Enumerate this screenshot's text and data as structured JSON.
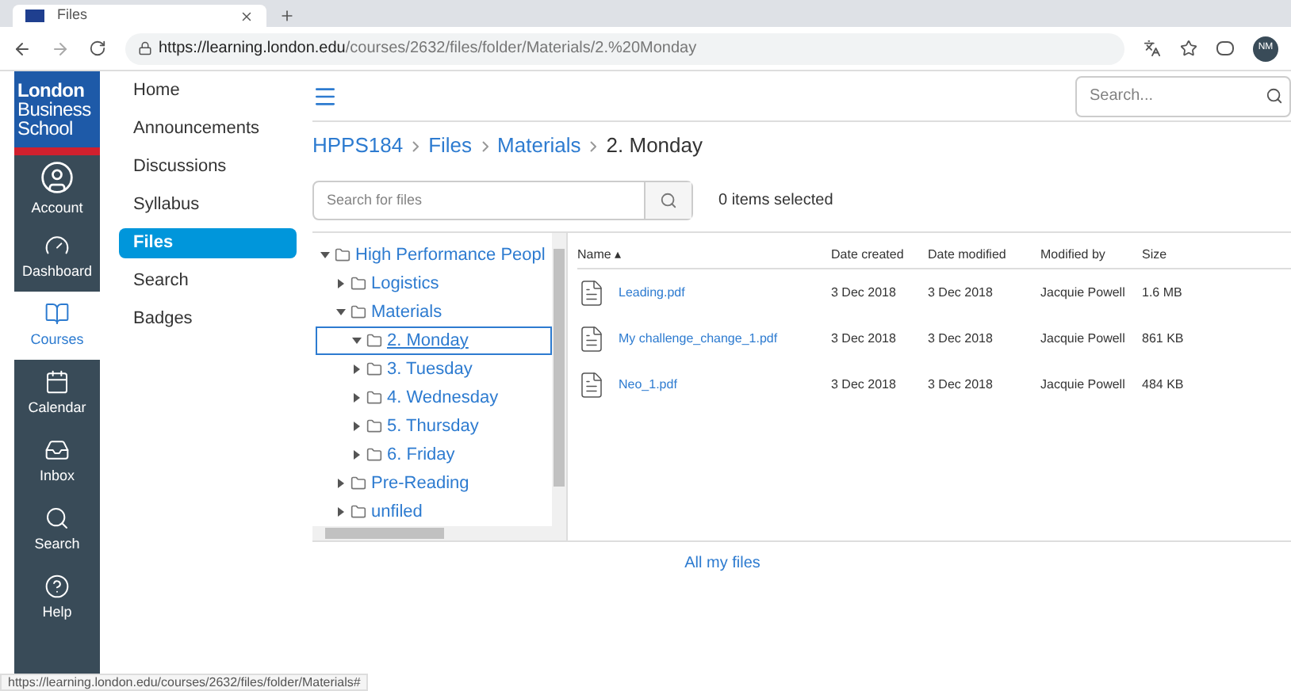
{
  "browser": {
    "tab_title": "Files",
    "url_host": "https://learning.london.edu",
    "url_path": "/courses/2632/files/folder/Materials/2.%20Monday",
    "profile": "NM"
  },
  "logo": [
    "London",
    "Business",
    "School"
  ],
  "global_nav": [
    {
      "label": "Account",
      "kind": "account",
      "selected": false
    },
    {
      "label": "Dashboard",
      "kind": "dashboard",
      "selected": false
    },
    {
      "label": "Courses",
      "kind": "courses",
      "selected": true
    },
    {
      "label": "Calendar",
      "kind": "calendar",
      "selected": false
    },
    {
      "label": "Inbox",
      "kind": "inbox",
      "selected": false
    },
    {
      "label": "Search",
      "kind": "search",
      "selected": false
    },
    {
      "label": "Help",
      "kind": "help",
      "selected": false
    }
  ],
  "course_nav": [
    {
      "label": "Home",
      "selected": false
    },
    {
      "label": "Announcements",
      "selected": false
    },
    {
      "label": "Discussions",
      "selected": false
    },
    {
      "label": "Syllabus",
      "selected": false
    },
    {
      "label": "Files",
      "selected": true
    },
    {
      "label": "Search",
      "selected": false
    },
    {
      "label": "Badges",
      "selected": false
    }
  ],
  "top_search": {
    "placeholder": "Search..."
  },
  "breadcrumbs": [
    "HPPS184",
    "Files",
    "Materials",
    "2. Monday"
  ],
  "file_search": {
    "placeholder": "Search for files"
  },
  "selection_count": "0 items selected",
  "folder_tree": [
    {
      "label": "High Performance Peopl",
      "expanded": true,
      "selected": false,
      "children": [
        {
          "label": "Logistics",
          "expanded": false,
          "selected": false
        },
        {
          "label": "Materials",
          "expanded": true,
          "selected": false,
          "children": [
            {
              "label": "2. Monday",
              "expanded": true,
              "selected": true
            },
            {
              "label": "3. Tuesday",
              "expanded": false,
              "selected": false
            },
            {
              "label": "4. Wednesday",
              "expanded": false,
              "selected": false
            },
            {
              "label": "5. Thursday",
              "expanded": false,
              "selected": false
            },
            {
              "label": "6. Friday",
              "expanded": false,
              "selected": false
            }
          ]
        },
        {
          "label": "Pre-Reading",
          "expanded": false,
          "selected": false
        },
        {
          "label": "unfiled",
          "expanded": false,
          "selected": false
        }
      ]
    }
  ],
  "table": {
    "columns": [
      "Name ▴",
      "Date created",
      "Date modified",
      "Modified by",
      "Size"
    ],
    "rows": [
      [
        "Leading.pdf",
        "3 Dec 2018",
        "3 Dec 2018",
        "Jacquie Powell",
        "1.6 MB"
      ],
      [
        "My challenge_change_1.pdf",
        "3 Dec 2018",
        "3 Dec 2018",
        "Jacquie Powell",
        "861 KB"
      ],
      [
        "Neo_1.pdf",
        "3 Dec 2018",
        "3 Dec 2018",
        "Jacquie Powell",
        "484 KB"
      ]
    ]
  },
  "all_files_link": "All my files",
  "status_bar": "https://learning.london.edu/courses/2632/files/folder/Materials#"
}
